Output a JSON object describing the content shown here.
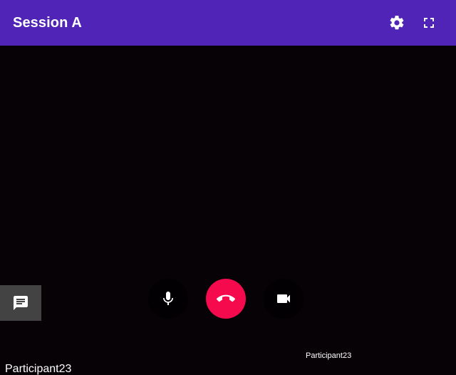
{
  "header": {
    "title": "Session A",
    "settings_icon": "gear-icon",
    "fullscreen_icon": "fullscreen-icon",
    "background_color": "#4f24b6"
  },
  "chat": {
    "icon": "chat-icon"
  },
  "controls": {
    "mic_icon": "microphone-icon",
    "hangup_icon": "call-end-icon",
    "camera_icon": "videocam-icon",
    "hangup_color": "#f50a4e"
  },
  "participants": {
    "remote_nickname": "Participant23",
    "local_nickname": "Participant23"
  },
  "video_background": "#060206"
}
